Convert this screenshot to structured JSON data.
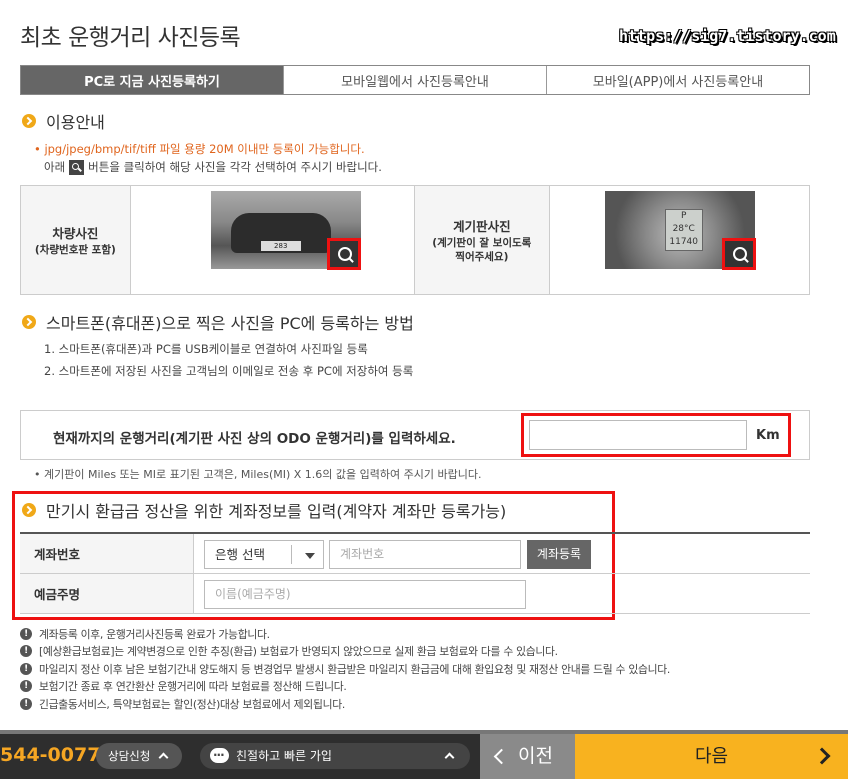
{
  "header": {
    "title": "최초 운행거리 사진등록",
    "watermark": "https://sig7.tistory.com"
  },
  "tabs": [
    {
      "label": "PC로 지금 사진등록하기"
    },
    {
      "label": "모바일웹에서 사진등록안내"
    },
    {
      "label": "모바일(APP)에서 사진등록안내"
    }
  ],
  "usage": {
    "title": "이용안내",
    "note_orange": "• jpg/jpeg/bmp/tif/tiff 파일 용량 20M 이내만 등록이 가능합니다.",
    "note_before_icon": "아래",
    "note_after_icon": "버튼을 클릭하여 해당 사진을 각각 선택하여 주시기 바랍니다."
  },
  "photos": {
    "car_label": "차량사진",
    "car_sub": "(차량번호판 포함)",
    "car_plate": "283",
    "dash_label": "계기판사진",
    "dash_sub": "(계기판이 잘 보이도록 찍어주세요)",
    "dash_p": "P",
    "dash_temp": "28°C",
    "dash_odo": "11740"
  },
  "smartphone": {
    "title": "스마트폰(휴대폰)으로 찍은 사진을 PC에 등록하는 방법",
    "step1": "1. 스마트폰(휴대폰)과 PC를 USB케이블로 연결하여 사진파일 등록",
    "step2": "2. 스마트폰에 저장된 사진을 고객님의 이메일로 전송 후 PC에 저장하여 등록"
  },
  "mileage": {
    "label": "현재까지의 운행거리(계기판 사진 상의 ODO 운행거리)를 입력하세요.",
    "value": "",
    "unit": "Km",
    "note": "• 계기판이 Miles 또는 MI로 표기된 고객은, Miles(MI) X 1.6의 값을 입력하여 주시기 바랍니다."
  },
  "account": {
    "title": "만기시 환급금 정산을 위한 계좌정보를 입력(계약자 계좌만 등록가능)",
    "row1_label": "계좌번호",
    "bank_select": "은행 선택",
    "account_placeholder": "계좌번호",
    "register_button": "계좌등록",
    "row2_label": "예금주명",
    "holder_placeholder": "이름(예금주명)"
  },
  "notices": [
    "계좌등록 이후, 운행거리사진등록 완료가 가능합니다.",
    "[예상환급보험료]는 계약변경으로 인한 추징(환급) 보험료가 반영되지 않았으므로 실제 환급 보험료와 다를 수 있습니다.",
    "마일리지 정산 이후 남은 보험기간내 양도해지 등 변경업무 발생시 환급받은 마일리지 환급금에 대해 환입요청 및 재정산 안내를 드릴 수 있습니다.",
    "보험기간 종료 후 연간환산 운행거리에 따라 보험료를 정산해 드립니다.",
    "긴급출동서비스, 특약보험료는 할인(정산)대상 보험료에서 제외됩니다."
  ],
  "footer": {
    "phone": "544-0077",
    "consult": "상담신청",
    "join": "친절하고 빠른 가입",
    "prev": "이전",
    "next": "다음"
  },
  "colors": {
    "accent_orange": "#f8b21f",
    "highlight_red": "#e11111",
    "tab_active": "#666666"
  }
}
